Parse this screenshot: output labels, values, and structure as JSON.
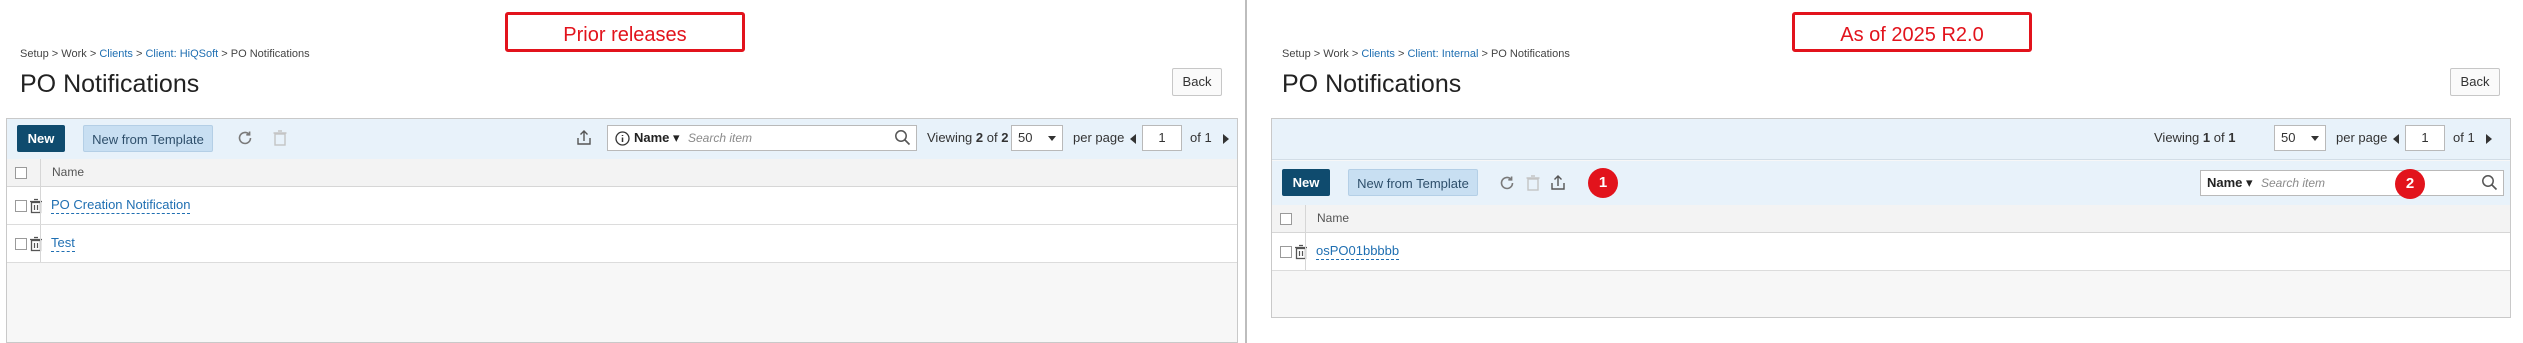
{
  "left": {
    "callout": "Prior releases",
    "breadcrumb": {
      "setup": "Setup",
      "work": "Work",
      "clients": "Clients",
      "client": "Client: HiQSoft",
      "current": "PO Notifications"
    },
    "title": "PO Notifications",
    "back": "Back",
    "toolbar": {
      "new": "New",
      "template": "New from Template"
    },
    "search": {
      "field": "Name",
      "placeholder": "Search item"
    },
    "pager": {
      "viewing_prefix": "Viewing",
      "viewing_count": "2",
      "viewing_of": "of",
      "viewing_total": "2",
      "page_size": "50",
      "per_page": "per page",
      "page": "1",
      "of_pages": "of 1"
    },
    "columns": {
      "name": "Name"
    },
    "rows": [
      {
        "name": "PO Creation Notification"
      },
      {
        "name": "Test"
      }
    ]
  },
  "right": {
    "callout": "As of 2025 R2.0",
    "breadcrumb": {
      "setup": "Setup",
      "work": "Work",
      "clients": "Clients",
      "client": "Client: Internal",
      "current": "PO Notifications"
    },
    "title": "PO Notifications",
    "back": "Back",
    "toolbar": {
      "new": "New",
      "template": "New from Template"
    },
    "search": {
      "field": "Name",
      "placeholder": "Search item"
    },
    "pager": {
      "viewing_prefix": "Viewing",
      "viewing_count": "1",
      "viewing_of": "of",
      "viewing_total": "1",
      "page_size": "50",
      "per_page": "per page",
      "page": "1",
      "of_pages": "of 1"
    },
    "columns": {
      "name": "Name"
    },
    "rows": [
      {
        "name": "osPO01bbbbb"
      }
    ],
    "badges": [
      "1",
      "2"
    ]
  },
  "colors": {
    "callout": "#e2131c",
    "new_button": "#0f4b6e",
    "template_button": "#c8dff2",
    "link": "#1f6fb2",
    "toolbar_bg": "#e8f2fa"
  },
  "icons": [
    "refresh-icon",
    "trash-icon",
    "export-icon",
    "info-icon",
    "search-icon",
    "chevron-left-icon",
    "chevron-right-icon"
  ]
}
